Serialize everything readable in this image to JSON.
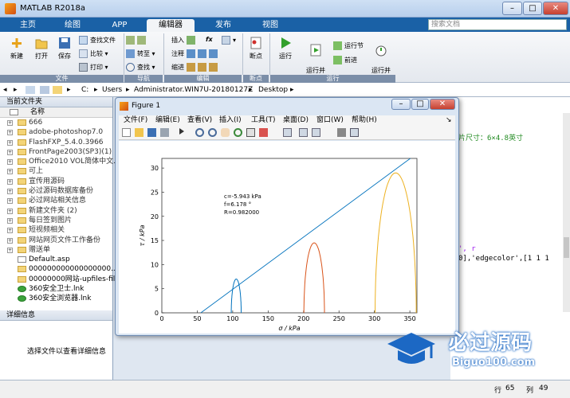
{
  "app": {
    "title": "MATLAB R2018a"
  },
  "window_controls": {
    "minimize": "–",
    "maximize": "□",
    "close": "✕"
  },
  "tabs": [
    "主页",
    "绘图",
    "APP",
    "编辑器",
    "发布",
    "视图"
  ],
  "search": {
    "placeholder": "搜索文档"
  },
  "ribbon": {
    "file_group": {
      "label": "文件",
      "new": "新建",
      "open": "打开",
      "save": "保存",
      "find_files": "查找文件",
      "compare": "比较",
      "print": "打印"
    },
    "nav_group": {
      "label": "导航",
      "goto": "转至",
      "find": "查找"
    },
    "edit_group": {
      "label": "编辑",
      "insert": "插入",
      "comment": "注释",
      "indent": "缩进",
      "fx": "fx"
    },
    "breakpoint_group": {
      "label": "断点",
      "breakpoints": "断点"
    },
    "run_group": {
      "label": "运行",
      "run": "运行",
      "run_advance": "运行并\n前进",
      "run_section": "运行节",
      "advance": "前进",
      "run_time": "运行并\n计时"
    }
  },
  "address": {
    "path": [
      "C:",
      "Users",
      "Administrator.WIN7U-20180127Z",
      "Desktop"
    ]
  },
  "current_folder": {
    "title": "当前文件夹",
    "column": "名称",
    "items": [
      {
        "name": "666",
        "type": "folder"
      },
      {
        "name": "adobe-photoshop7.0",
        "type": "folder"
      },
      {
        "name": "FlashFXP_5.4.0.3966",
        "type": "folder"
      },
      {
        "name": "FrontPage2003(SP3)(1)",
        "type": "folder"
      },
      {
        "name": "Office2010 VOL简体中文...",
        "type": "folder"
      },
      {
        "name": "可上",
        "type": "folder"
      },
      {
        "name": "宣传用源码",
        "type": "folder"
      },
      {
        "name": "必过源码数据库备份",
        "type": "folder"
      },
      {
        "name": "必过网站相关信息",
        "type": "folder"
      },
      {
        "name": "新建文件夹 (2)",
        "type": "folder"
      },
      {
        "name": "每日签到图片",
        "type": "folder"
      },
      {
        "name": "短视频相关",
        "type": "folder"
      },
      {
        "name": "网站网页文件工作备份",
        "type": "folder"
      },
      {
        "name": "赠送单",
        "type": "folder"
      },
      {
        "name": "Default.asp",
        "type": "file"
      },
      {
        "name": "000000000000000000...",
        "type": "file"
      },
      {
        "name": "00000000网站-upfiles-fil...",
        "type": "file"
      },
      {
        "name": "360安全卫士.lnk",
        "type": "file"
      },
      {
        "name": "360安全浏览器.lnk",
        "type": "file"
      }
    ]
  },
  "details": {
    "title": "详细信息",
    "hint": "选择文件以查看详细信息"
  },
  "editor_snippets": {
    "line1": "片尺寸：6×4.8英寸",
    "line2": "', r",
    "line3": "0],'edgecolor',[1 1 1"
  },
  "status_bar": {
    "row_label": "行",
    "row": "65",
    "col_label": "列",
    "col": "49"
  },
  "figure": {
    "title": "Figure 1",
    "menu": [
      "文件(F)",
      "编辑(E)",
      "查看(V)",
      "插入(I)",
      "工具(T)",
      "桌面(D)",
      "窗口(W)",
      "帮助(H)"
    ],
    "annotations": [
      "c=-5.943 kPa",
      "f=6.178 °",
      "R=0.982000"
    ]
  },
  "chart_data": {
    "type": "line",
    "xlabel": "σ / kPa",
    "ylabel": "τ / kPa",
    "xlim": [
      0,
      360
    ],
    "ylim": [
      0,
      32
    ],
    "xticks": [
      0,
      50,
      100,
      150,
      200,
      250,
      300,
      350
    ],
    "yticks": [
      0,
      5,
      10,
      15,
      20,
      25,
      30
    ],
    "grid": false,
    "series": [
      {
        "kind": "semicircle",
        "center": 105,
        "radius": 7,
        "color": "#0072bd"
      },
      {
        "kind": "semicircle",
        "center": 215,
        "radius": 14.5,
        "color": "#d95319"
      },
      {
        "kind": "semicircle",
        "center": 330,
        "radius": 29,
        "color": "#edb120"
      },
      {
        "kind": "line",
        "points": [
          [
            55.0,
            0.0
          ],
          [
            360.0,
            33.0
          ]
        ],
        "color": "#0072bd"
      }
    ]
  },
  "watermark": {
    "brand": "必过源码",
    "url": "Biguo100.com"
  },
  "colors": {
    "tab_bar": "#1a61a6",
    "accent": "#0072bd"
  }
}
